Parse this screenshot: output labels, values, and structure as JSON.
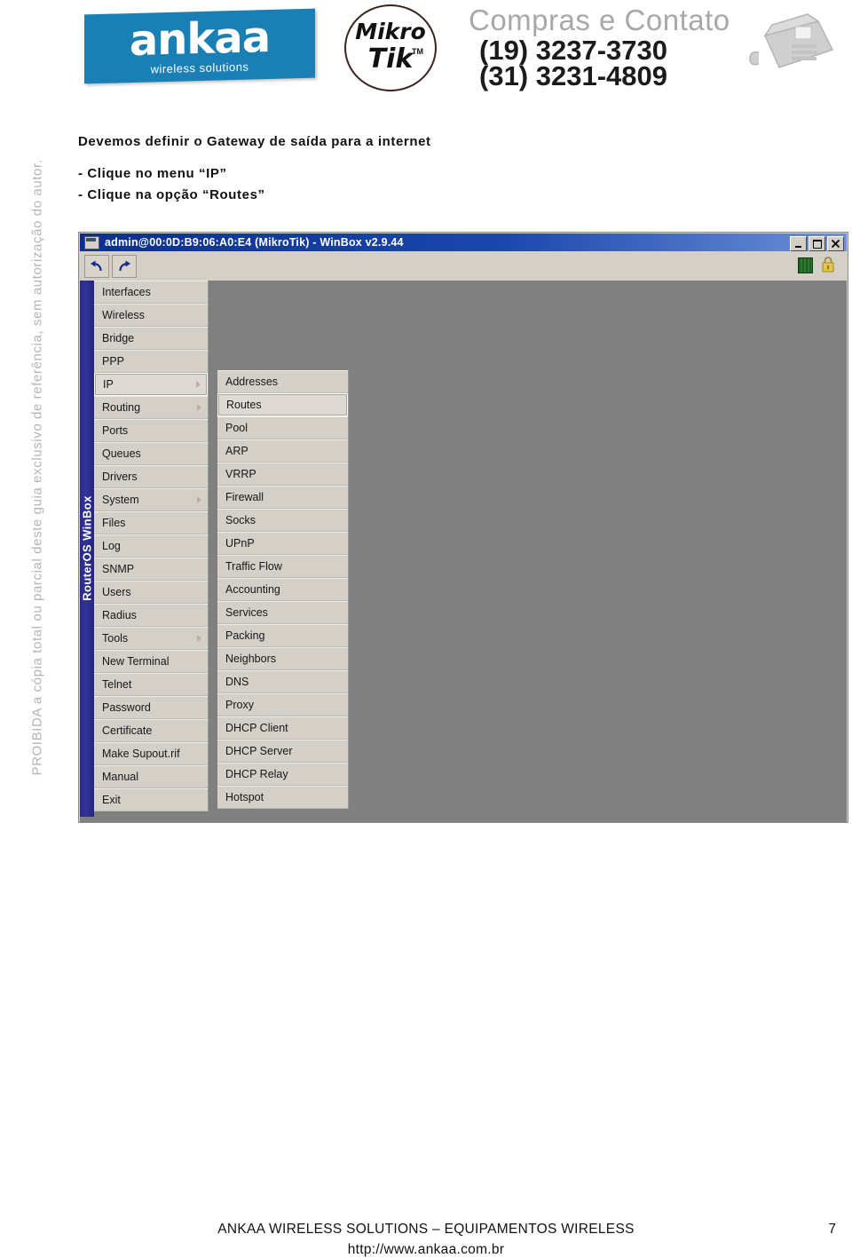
{
  "header": {
    "brand_name": "ankaa",
    "brand_tagline": "wireless solutions",
    "brand_color": "#1a7fb5",
    "partner_logo_line1": "Mikro",
    "partner_logo_line2": "Tik",
    "partner_logo_tm": "TM",
    "contact_title": "Compras e Contato",
    "contact_phone_1": "(19) 3237-3730",
    "contact_phone_2": "(31) 3231-4809",
    "phone_icon_name": "desk-phone-icon"
  },
  "watermark": {
    "text": "PROIBIDA a cópia total ou parcial deste guia exclusivo de referência, sem autorização do autor."
  },
  "instructions": {
    "title": "Devemos definir o Gateway de saída para a internet",
    "steps": [
      "- Clique no menu “IP”",
      "- Clique na opção “Routes”"
    ]
  },
  "winbox": {
    "title": "admin@00:0D:B9:06:A0:E4 (MikroTik) - WinBox v2.9.44",
    "titlebar_color": "#1b47ad",
    "window_controls": [
      {
        "name": "minimize-button",
        "glyph": "_"
      },
      {
        "name": "maximize-button",
        "glyph": "□"
      },
      {
        "name": "close-button",
        "glyph": "✕"
      }
    ],
    "toolbar": {
      "undo_label": "↰",
      "redo_label": "↱",
      "status_indicator_color": "#2e7a30",
      "lock_icon_color": "#e3c54a"
    },
    "sidebar_label": "RouterOS WinBox",
    "main_menu": [
      {
        "label": "Interfaces",
        "has_submenu": false,
        "selected": false
      },
      {
        "label": "Wireless",
        "has_submenu": false,
        "selected": false
      },
      {
        "label": "Bridge",
        "has_submenu": false,
        "selected": false
      },
      {
        "label": "PPP",
        "has_submenu": false,
        "selected": false
      },
      {
        "label": "IP",
        "has_submenu": true,
        "selected": true
      },
      {
        "label": "Routing",
        "has_submenu": true,
        "selected": false
      },
      {
        "label": "Ports",
        "has_submenu": false,
        "selected": false
      },
      {
        "label": "Queues",
        "has_submenu": false,
        "selected": false
      },
      {
        "label": "Drivers",
        "has_submenu": false,
        "selected": false
      },
      {
        "label": "System",
        "has_submenu": true,
        "selected": false
      },
      {
        "label": "Files",
        "has_submenu": false,
        "selected": false
      },
      {
        "label": "Log",
        "has_submenu": false,
        "selected": false
      },
      {
        "label": "SNMP",
        "has_submenu": false,
        "selected": false
      },
      {
        "label": "Users",
        "has_submenu": false,
        "selected": false
      },
      {
        "label": "Radius",
        "has_submenu": false,
        "selected": false
      },
      {
        "label": "Tools",
        "has_submenu": true,
        "selected": false
      },
      {
        "label": "New Terminal",
        "has_submenu": false,
        "selected": false
      },
      {
        "label": "Telnet",
        "has_submenu": false,
        "selected": false
      },
      {
        "label": "Password",
        "has_submenu": false,
        "selected": false
      },
      {
        "label": "Certificate",
        "has_submenu": false,
        "selected": false
      },
      {
        "label": "Make Supout.rif",
        "has_submenu": false,
        "selected": false
      },
      {
        "label": "Manual",
        "has_submenu": false,
        "selected": false
      },
      {
        "label": "Exit",
        "has_submenu": false,
        "selected": false
      }
    ],
    "sub_menu": [
      {
        "label": "Addresses",
        "selected": false
      },
      {
        "label": "Routes",
        "selected": true
      },
      {
        "label": "Pool",
        "selected": false
      },
      {
        "label": "ARP",
        "selected": false
      },
      {
        "label": "VRRP",
        "selected": false
      },
      {
        "label": "Firewall",
        "selected": false
      },
      {
        "label": "Socks",
        "selected": false
      },
      {
        "label": "UPnP",
        "selected": false
      },
      {
        "label": "Traffic Flow",
        "selected": false
      },
      {
        "label": "Accounting",
        "selected": false
      },
      {
        "label": "Services",
        "selected": false
      },
      {
        "label": "Packing",
        "selected": false
      },
      {
        "label": "Neighbors",
        "selected": false
      },
      {
        "label": "DNS",
        "selected": false
      },
      {
        "label": "Proxy",
        "selected": false
      },
      {
        "label": "DHCP Client",
        "selected": false
      },
      {
        "label": "DHCP Server",
        "selected": false
      },
      {
        "label": "DHCP Relay",
        "selected": false
      },
      {
        "label": "Hotspot",
        "selected": false
      }
    ]
  },
  "footer": {
    "company_line": "ANKAA WIRELESS SOLUTIONS – EQUIPAMENTOS WIRELESS",
    "page_number": "7",
    "website": "http://www.ankaa.com.br"
  }
}
